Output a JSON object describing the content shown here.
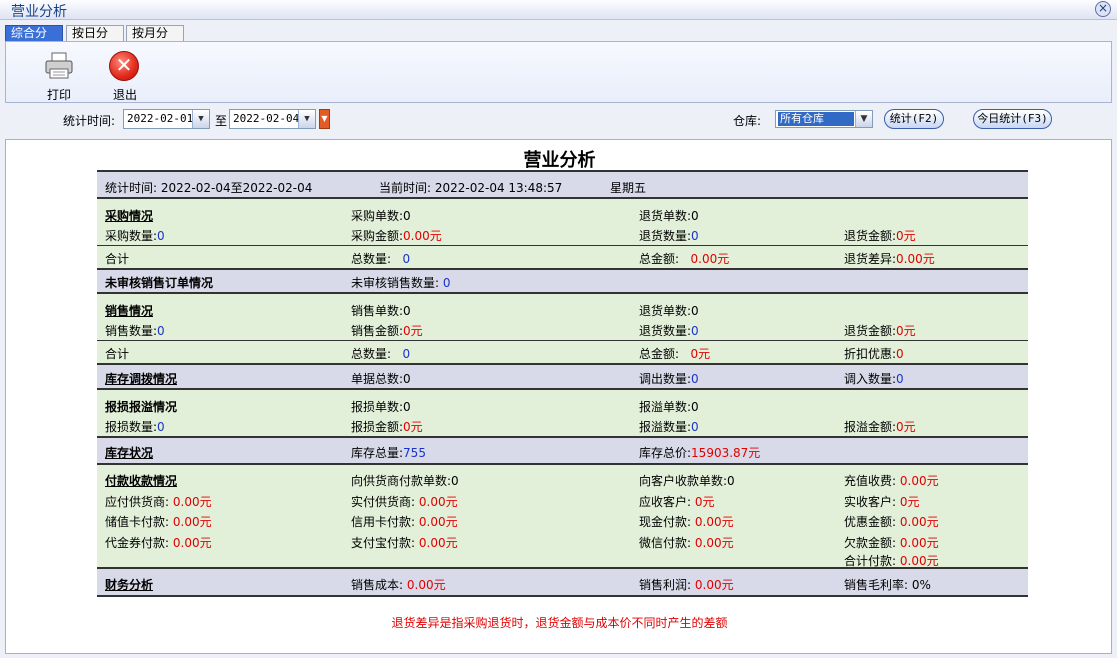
{
  "window": {
    "title": "营业分析"
  },
  "tabs": [
    "综合分析",
    "按日分析",
    "按月分析"
  ],
  "toolbar": {
    "print_label": "打印",
    "exit_label": "退出"
  },
  "filter": {
    "time_label": "统计时间:",
    "date_from": "2022-02-01",
    "to_label": "至",
    "date_to": "2022-02-04",
    "warehouse_label": "仓库:",
    "warehouse_value": "所有仓库",
    "stat_button": "统计(F2)",
    "today_button": "今日统计(F3)"
  },
  "report": {
    "title": "营业分析",
    "header": {
      "period": "统计时间: 2022-02-04至2022-02-04",
      "now": "当前时间: 2022-02-04 13:48:57",
      "weekday": "星期五"
    },
    "purchase": {
      "title": "采购情况",
      "count_label": "采购单数:",
      "count": "0",
      "return_count_label": "退货单数:",
      "return_count": "0",
      "qty_label": "采购数量:",
      "qty": "0",
      "amount_label": "采购金额:",
      "amount": "0.00元",
      "return_qty_label": "退货数量:",
      "return_qty": "0",
      "return_amount_label": "退货金额:",
      "return_amount": "0元",
      "total_label": "合计",
      "total_qty_label": "总数量:",
      "total_qty": "0",
      "total_amount_label": "总金额:",
      "total_amount": "0.00元",
      "return_diff_label": "退货差异:",
      "return_diff": "0.00元"
    },
    "unaudited": {
      "title": "未审核销售订单情况",
      "label": "未审核销售数量:",
      "value": "0"
    },
    "sales": {
      "title": "销售情况",
      "count_label": "销售单数:",
      "count": "0",
      "return_count_label": "退货单数:",
      "return_count": "0",
      "qty_label": "销售数量:",
      "qty": "0",
      "amount_label": "销售金额:",
      "amount": "0元",
      "return_qty_label": "退货数量:",
      "return_qty": "0",
      "return_amount_label": "退货金额:",
      "return_amount": "0元",
      "total_label": "合计",
      "total_qty_label": "总数量:",
      "total_qty": "0",
      "total_amount_label": "总金额:",
      "total_amount": "0元",
      "discount_label": "折扣优惠:",
      "discount": "0"
    },
    "transfer": {
      "title": "库存调拨情况",
      "docs_label": "单据总数:",
      "docs": "0",
      "out_label": "调出数量:",
      "out": "0",
      "in_label": "调入数量:",
      "in": "0"
    },
    "loss": {
      "title": "报损报溢情况",
      "loss_count_label": "报损单数:",
      "loss_count": "0",
      "gain_count_label": "报溢单数:",
      "gain_count": "0",
      "loss_qty_label": "报损数量:",
      "loss_qty": "0",
      "loss_amount_label": "报损金额:",
      "loss_amount": "0元",
      "gain_qty_label": "报溢数量:",
      "gain_qty": "0",
      "gain_amount_label": "报溢金额:",
      "gain_amount": "0元"
    },
    "stock": {
      "title": "库存状况",
      "qty_label": "库存总量:",
      "qty": "755",
      "value_label": "库存总价:",
      "value": "15903.87元"
    },
    "payment": {
      "title": "付款收款情况",
      "supplier_pay_count_label": "向供货商付款单数:",
      "supplier_pay_count": "0",
      "customer_recv_count_label": "向客户收款单数:",
      "customer_recv_count": "0",
      "recharge_label": "充值收费:",
      "recharge": "0.00元",
      "payable_label": "应付供货商:",
      "payable": "0.00元",
      "paid_label": "实付供货商:",
      "paid": "0.00元",
      "receivable_label": "应收客户:",
      "receivable": "0元",
      "received_label": "实收客户:",
      "received": "0元",
      "stored_card_label": "储值卡付款:",
      "stored_card": "0.00元",
      "credit_card_label": "信用卡付款:",
      "credit_card": "0.00元",
      "cash_label": "现金付款:",
      "cash": "0.00元",
      "discount_amt_label": "优惠金额:",
      "discount_amt": "0.00元",
      "voucher_label": "代金券付款:",
      "voucher": "0.00元",
      "alipay_label": "支付宝付款:",
      "alipay": "0.00元",
      "wechat_label": "微信付款:",
      "wechat": "0.00元",
      "owed_label": "欠款金额:",
      "owed": "0.00元",
      "total_pay_label": "合计付款:",
      "total_pay": "0.00元"
    },
    "finance": {
      "title": "财务分析",
      "cost_label": "销售成本:",
      "cost": "0.00元",
      "profit_label": "销售利润:",
      "profit": "0.00元",
      "margin_label": "销售毛利率:",
      "margin": "0%"
    },
    "note": "退货差异是指采购退货时，退货金额与成本价不同时产生的差额"
  }
}
